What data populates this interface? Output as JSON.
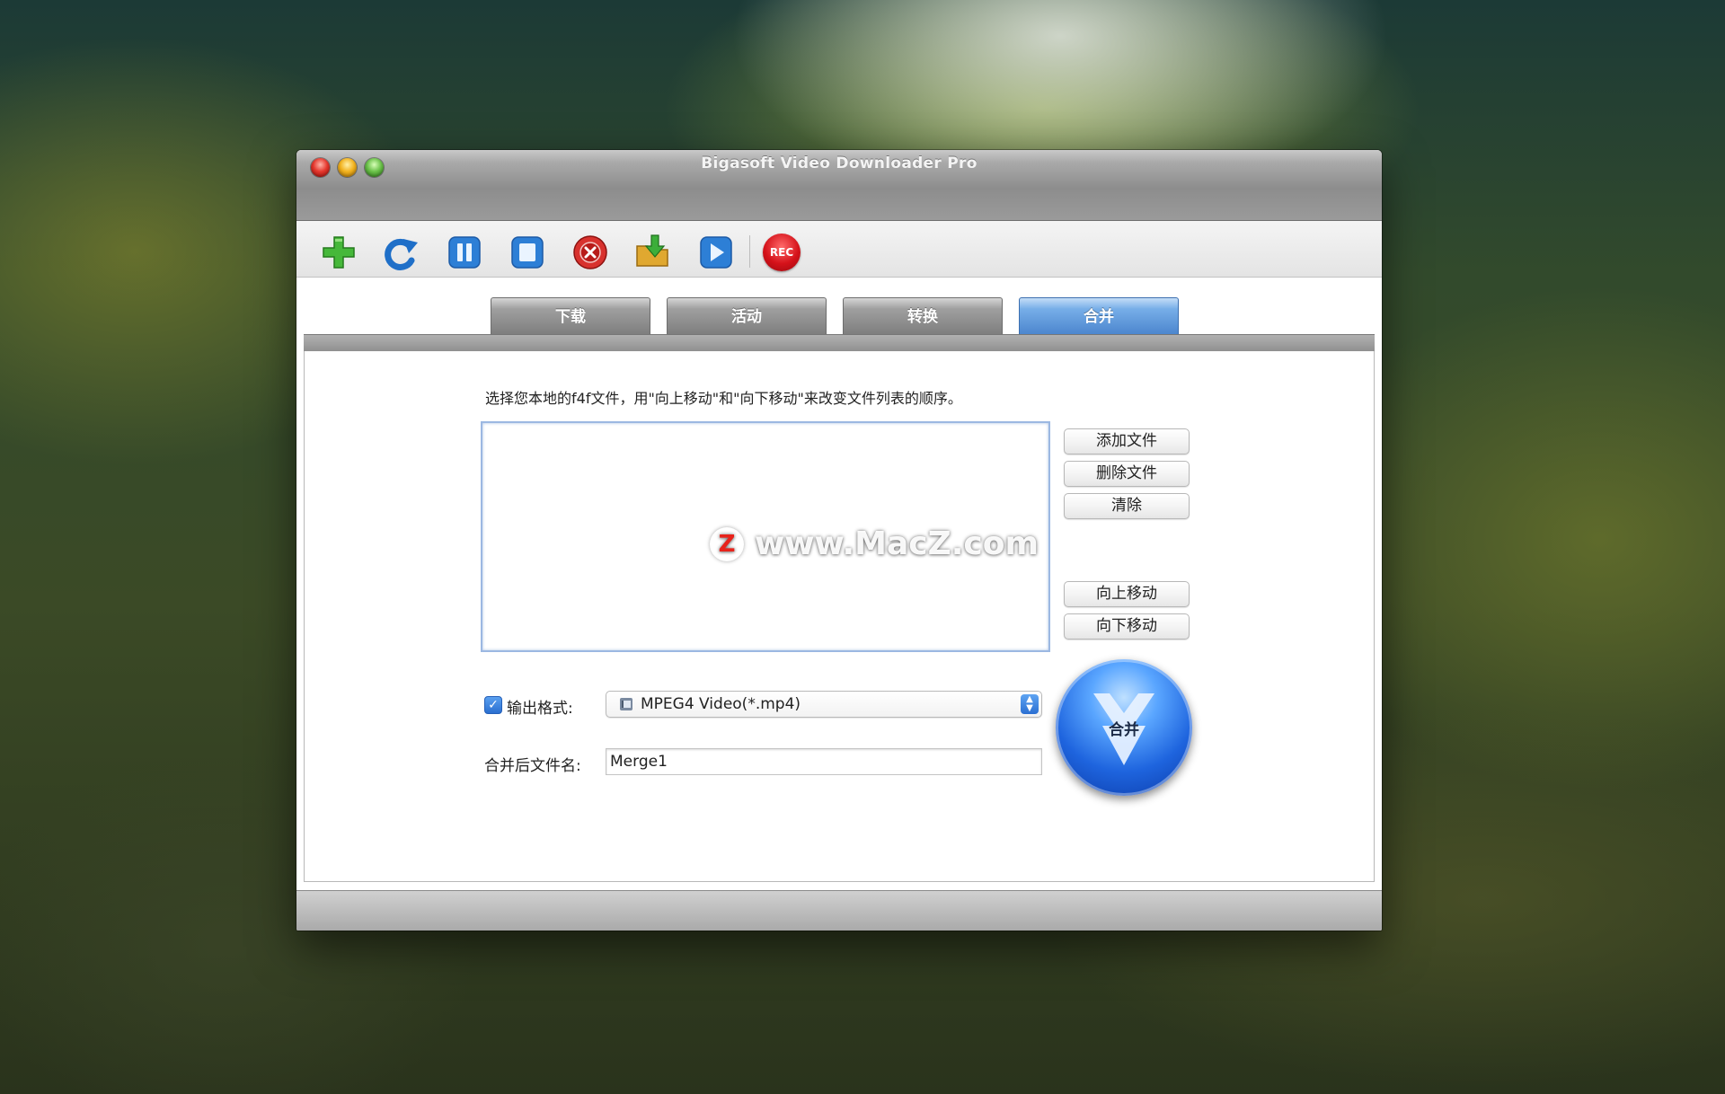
{
  "window": {
    "title": "Bigasoft Video Downloader Pro"
  },
  "toolbar": {
    "items": [
      {
        "icon": "add-icon",
        "color": "#3cb43c"
      },
      {
        "icon": "refresh-icon",
        "color": "#2a7fd4"
      },
      {
        "icon": "pause-icon",
        "color": "#2a7fd4"
      },
      {
        "icon": "stop-icon",
        "color": "#2a7fd4"
      },
      {
        "icon": "cancel-icon",
        "color": "#d42a2a"
      },
      {
        "icon": "open-folder-icon",
        "color": "#d9a62a"
      },
      {
        "icon": "play-icon",
        "color": "#2a7fd4"
      }
    ],
    "rec_label": "REC"
  },
  "tabs": [
    {
      "label": "下载",
      "active": false
    },
    {
      "label": "活动",
      "active": false
    },
    {
      "label": "转换",
      "active": false
    },
    {
      "label": "合并",
      "active": true
    }
  ],
  "merge": {
    "instruction": "选择您本地的f4f文件，用\"向上移动\"和\"向下移动\"来改变文件列表的顺序。",
    "buttons": {
      "add_file": "添加文件",
      "delete_file": "删除文件",
      "clear": "清除",
      "move_up": "向上移动",
      "move_down": "向下移动"
    },
    "output_format_label": "输出格式:",
    "output_format_checked": true,
    "output_format_value": "MPEG4 Video(*.mp4)",
    "filename_label": "合并后文件名:",
    "filename_value": "Merge1",
    "merge_button_label": "合并"
  },
  "watermark": {
    "logo_letter": "Z",
    "text": "www.MacZ.com"
  },
  "colors": {
    "accent": "#2b6fd2",
    "active_tab": "#4c86ce",
    "rec": "#d5121a"
  }
}
